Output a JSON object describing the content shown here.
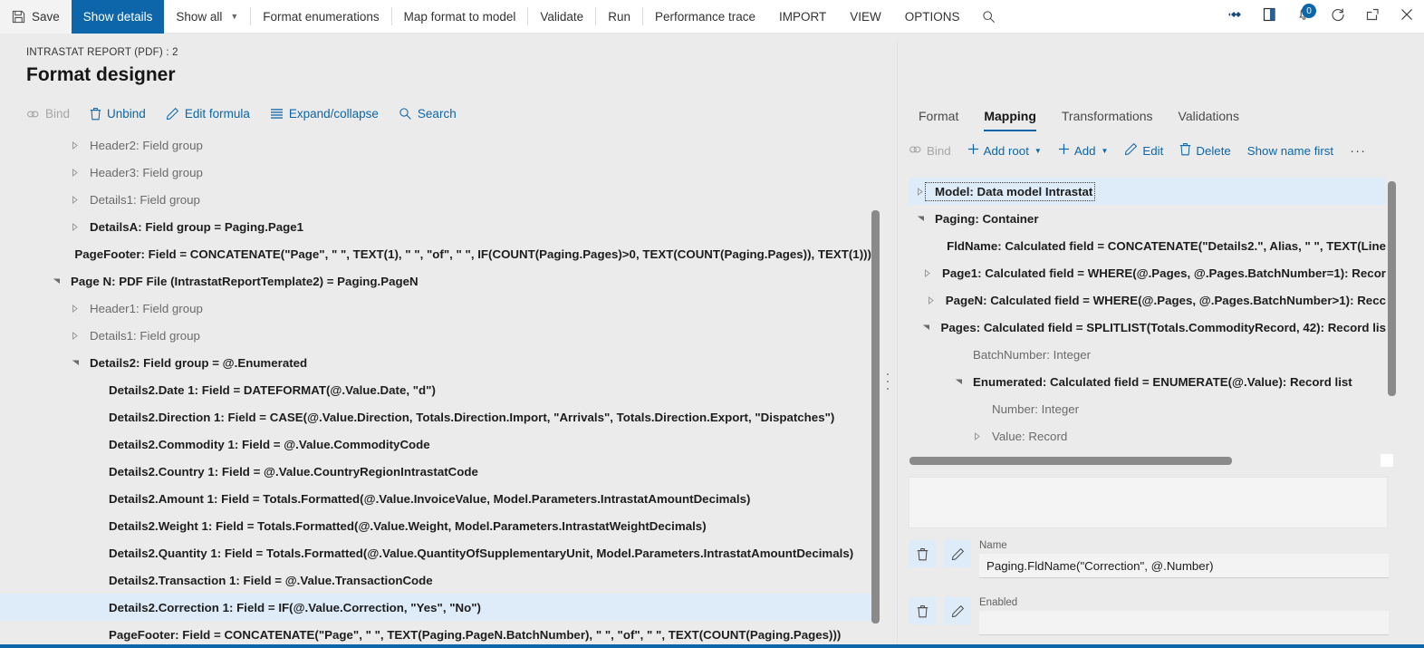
{
  "topbar": {
    "save_label": "Save",
    "show_details_label": "Show details",
    "show_all_label": "Show all",
    "format_enumerations_label": "Format enumerations",
    "map_format_to_model_label": "Map format to model",
    "validate_label": "Validate",
    "run_label": "Run",
    "performance_trace_label": "Performance trace",
    "import_label": "IMPORT",
    "view_label": "VIEW",
    "options_label": "OPTIONS",
    "notification_count": "0",
    "accent_color": "#0c66a9"
  },
  "header": {
    "caption": "INTRASTAT REPORT (PDF) : 2",
    "title": "Format designer"
  },
  "left_actions": [
    {
      "label": "Bind",
      "icon": "link-icon",
      "disabled": true
    },
    {
      "label": "Unbind",
      "icon": "trash-icon",
      "disabled": false
    },
    {
      "label": "Edit formula",
      "icon": "pencil-icon",
      "disabled": false
    },
    {
      "label": "Expand/collapse",
      "icon": "list-icon",
      "disabled": false
    },
    {
      "label": "Search",
      "icon": "search-icon",
      "disabled": false
    }
  ],
  "left_tree": [
    {
      "label": "Header2: Field group",
      "indent": 1,
      "twisty": "collapsed",
      "style": "muted"
    },
    {
      "label": "Header3: Field group",
      "indent": 1,
      "twisty": "collapsed",
      "style": "muted"
    },
    {
      "label": "Details1: Field group",
      "indent": 1,
      "twisty": "collapsed",
      "style": "muted"
    },
    {
      "label": "DetailsA: Field group = Paging.Page1",
      "indent": 1,
      "twisty": "collapsed",
      "style": "bold"
    },
    {
      "label": "PageFooter: Field = CONCATENATE(\"Page\", \" \", TEXT(1), \" \", \"of\", \" \", IF(COUNT(Paging.Pages)>0, TEXT(COUNT(Paging.Pages)), TEXT(1)))",
      "indent": 2,
      "twisty": "none",
      "style": "bold"
    },
    {
      "label": "Page N: PDF File (IntrastatReportTemplate2) = Paging.PageN",
      "indent": 0,
      "twisty": "expanded",
      "style": "bold"
    },
    {
      "label": "Header1: Field group",
      "indent": 1,
      "twisty": "collapsed",
      "style": "muted"
    },
    {
      "label": "Details1: Field group",
      "indent": 1,
      "twisty": "collapsed",
      "style": "muted"
    },
    {
      "label": "Details2: Field group = @.Enumerated",
      "indent": 1,
      "twisty": "expanded",
      "style": "bold"
    },
    {
      "label": "Details2.Date 1: Field = DATEFORMAT(@.Value.Date, \"d\")",
      "indent": 2,
      "twisty": "none",
      "style": "bold"
    },
    {
      "label": "Details2.Direction 1: Field = CASE(@.Value.Direction, Totals.Direction.Import, \"Arrivals\", Totals.Direction.Export, \"Dispatches\")",
      "indent": 2,
      "twisty": "none",
      "style": "bold"
    },
    {
      "label": "Details2.Commodity 1: Field = @.Value.CommodityCode",
      "indent": 2,
      "twisty": "none",
      "style": "bold"
    },
    {
      "label": "Details2.Country 1: Field = @.Value.CountryRegionIntrastatCode",
      "indent": 2,
      "twisty": "none",
      "style": "bold"
    },
    {
      "label": "Details2.Amount 1: Field = Totals.Formatted(@.Value.InvoiceValue, Model.Parameters.IntrastatAmountDecimals)",
      "indent": 2,
      "twisty": "none",
      "style": "bold"
    },
    {
      "label": "Details2.Weight 1: Field = Totals.Formatted(@.Value.Weight, Model.Parameters.IntrastatWeightDecimals)",
      "indent": 2,
      "twisty": "none",
      "style": "bold"
    },
    {
      "label": "Details2.Quantity 1: Field = Totals.Formatted(@.Value.QuantityOfSupplementaryUnit, Model.Parameters.IntrastatAmountDecimals)",
      "indent": 2,
      "twisty": "none",
      "style": "bold"
    },
    {
      "label": "Details2.Transaction 1: Field = @.Value.TransactionCode",
      "indent": 2,
      "twisty": "none",
      "style": "bold"
    },
    {
      "label": "Details2.Correction 1: Field = IF(@.Value.Correction, \"Yes\", \"No\")",
      "indent": 2,
      "twisty": "none",
      "style": "bold",
      "selected": true
    },
    {
      "label": "PageFooter: Field = CONCATENATE(\"Page\", \" \", TEXT(Paging.PageN.BatchNumber), \" \", \"of\", \" \", TEXT(COUNT(Paging.Pages)))",
      "indent": 2,
      "twisty": "none",
      "style": "bold"
    }
  ],
  "right_tabs": [
    {
      "label": "Format",
      "active": false
    },
    {
      "label": "Mapping",
      "active": true
    },
    {
      "label": "Transformations",
      "active": false
    },
    {
      "label": "Validations",
      "active": false
    }
  ],
  "right_actions": [
    {
      "label": "Bind",
      "icon": "link-icon",
      "disabled": true,
      "plus": false,
      "caret": false
    },
    {
      "label": "Add root",
      "icon": "plus-icon",
      "disabled": false,
      "plus": true,
      "caret": true
    },
    {
      "label": "Add",
      "icon": "plus-icon",
      "disabled": false,
      "plus": true,
      "caret": true
    },
    {
      "label": "Edit",
      "icon": "pencil-icon",
      "disabled": false,
      "plus": false,
      "caret": false
    },
    {
      "label": "Delete",
      "icon": "trash-icon",
      "disabled": false,
      "plus": false,
      "caret": false
    },
    {
      "label": "Show name first",
      "icon": "none",
      "disabled": false,
      "plus": false,
      "caret": false
    },
    {
      "label": "···",
      "icon": "overflow-icon",
      "disabled": false,
      "plus": false,
      "caret": false
    }
  ],
  "right_tree": [
    {
      "label": "Model: Data model Intrastat",
      "indent": 0,
      "twisty": "collapsed",
      "style": "strong",
      "selected": true,
      "focused": true
    },
    {
      "label": "Paging: Container",
      "indent": 0,
      "twisty": "expanded",
      "style": "strong"
    },
    {
      "label": "FldName: Calculated field = CONCATENATE(\"Details2.\", Alias, \" \", TEXT(Line",
      "indent": 1,
      "twisty": "none",
      "style": "strong"
    },
    {
      "label": "Page1: Calculated field = WHERE(@.Pages, @.Pages.BatchNumber=1): Recor",
      "indent": 1,
      "twisty": "collapsed",
      "style": "strong"
    },
    {
      "label": "PageN: Calculated field = WHERE(@.Pages, @.Pages.BatchNumber>1): Recc",
      "indent": 1,
      "twisty": "collapsed",
      "style": "strong"
    },
    {
      "label": "Pages: Calculated field = SPLITLIST(Totals.CommodityRecord, 42): Record lis",
      "indent": 1,
      "twisty": "expanded",
      "style": "strong"
    },
    {
      "label": "BatchNumber: Integer",
      "indent": 2,
      "twisty": "none",
      "style": "muted"
    },
    {
      "label": "Enumerated: Calculated field = ENUMERATE(@.Value): Record list",
      "indent": 2,
      "twisty": "expanded",
      "style": "strong"
    },
    {
      "label": "Number: Integer",
      "indent": 3,
      "twisty": "none",
      "style": "muted"
    },
    {
      "label": "Value: Record",
      "indent": 3,
      "twisty": "collapsed",
      "style": "muted"
    }
  ],
  "properties": [
    {
      "label": "Name",
      "value": "Paging.FldName(\"Correction\", @.Number)"
    },
    {
      "label": "Enabled",
      "value": ""
    }
  ]
}
